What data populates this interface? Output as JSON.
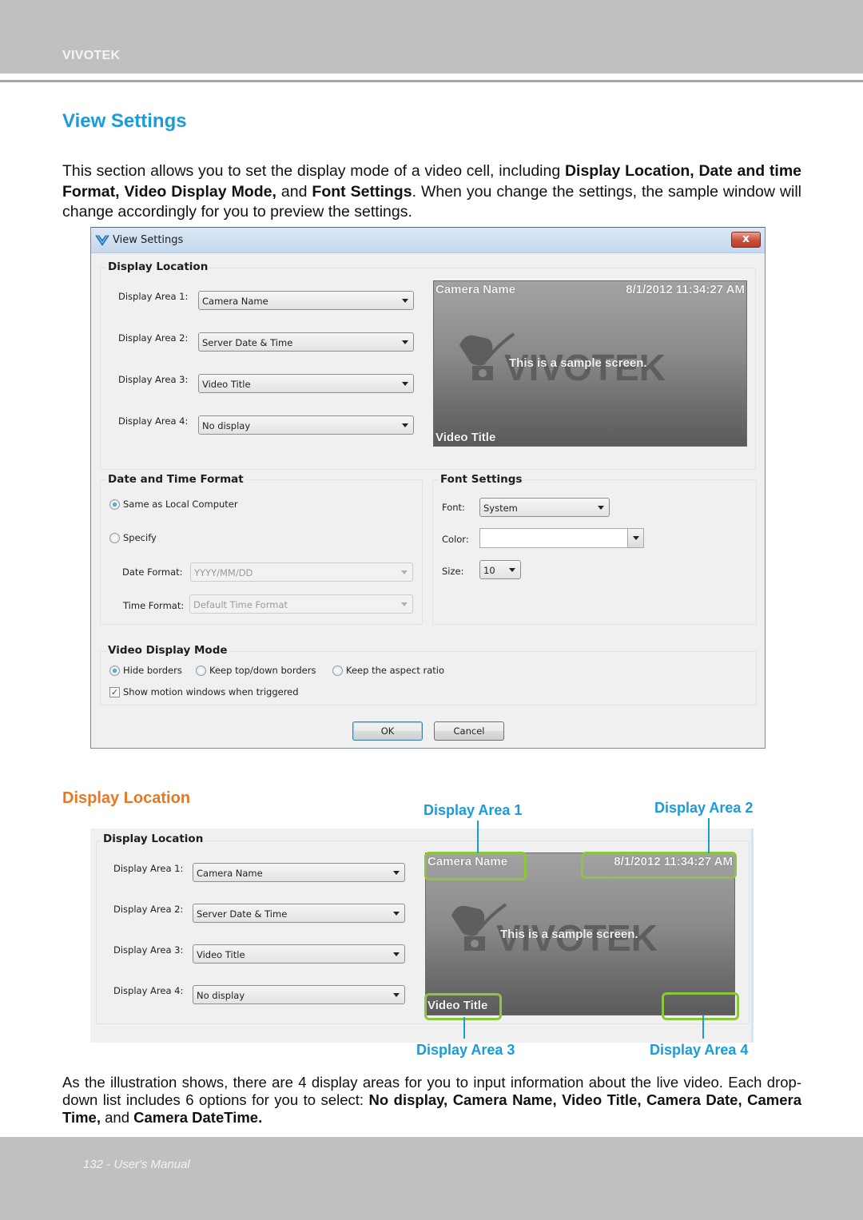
{
  "header": {
    "brand": "VIVOTEK"
  },
  "section_title": "View Settings",
  "intro": {
    "parts": [
      {
        "t": "This section allows you to set the display mode of a video cell, including ",
        "b": false
      },
      {
        "t": "Display Location, Date and time Format, Video Display Mode,",
        "b": true
      },
      {
        "t": " and ",
        "b": false
      },
      {
        "t": "Font Settings",
        "b": true
      },
      {
        "t": ". When you change the settings, the sample window will change accordingly for you to preview the settings.",
        "b": false
      }
    ]
  },
  "dialog": {
    "title": "View Settings",
    "close_glyph": "x",
    "display_location": {
      "title": "Display Location",
      "areas": [
        {
          "label": "Display Area 1:",
          "value": "Camera Name"
        },
        {
          "label": "Display Area 2:",
          "value": "Server Date & Time"
        },
        {
          "label": "Display Area 3:",
          "value": "Video Title"
        },
        {
          "label": "Display Area 4:",
          "value": "No display"
        }
      ]
    },
    "preview": {
      "top_left": "Camera Name",
      "top_right": "8/1/2012 11:34:27 AM",
      "center": "This is a sample screen.",
      "bottom_left": "Video Title",
      "watermark": "VIVOTEK"
    },
    "date_time_format": {
      "title": "Date and Time Format",
      "option_local": "Same as Local Computer",
      "option_specify": "Specify",
      "selected": "local",
      "date_format_label": "Date Format:",
      "date_format_value": "YYYY/MM/DD",
      "time_format_label": "Time Format:",
      "time_format_value": "Default Time Format"
    },
    "font_settings": {
      "title": "Font Settings",
      "font_label": "Font:",
      "font_value": "System",
      "color_label": "Color:",
      "color_value": "#ffffff",
      "size_label": "Size:",
      "size_value": "10"
    },
    "video_display_mode": {
      "title": "Video Display Mode",
      "options": [
        "Hide borders",
        "Keep top/down borders",
        "Keep the aspect ratio"
      ],
      "selected_index": 0,
      "motion_checkbox_label": "Show motion windows when triggered",
      "motion_checked": true
    },
    "ok_label": "OK",
    "cancel_label": "Cancel"
  },
  "subsection_title": "Display Location",
  "illustration": {
    "group_title": "Display Location",
    "areas": [
      {
        "label": "Display Area 1:",
        "value": "Camera Name"
      },
      {
        "label": "Display Area 2:",
        "value": "Server Date & Time"
      },
      {
        "label": "Display Area 3:",
        "value": "Video Title"
      },
      {
        "label": "Display Area 4:",
        "value": "No display"
      }
    ],
    "preview": {
      "top_left": "Camera Name",
      "top_right": "8/1/2012 11:34:27 AM",
      "center": "This is a sample screen.",
      "bottom_left": "Video Title",
      "watermark": "VIVOTEK"
    },
    "callouts": [
      "Display Area 1",
      "Display Area 2",
      "Display Area 3",
      "Display Area 4"
    ],
    "highlight_color": "#8cc63e",
    "callout_color": "#1a9bdc"
  },
  "outro": {
    "parts": [
      {
        "t": "As the illustration shows, there are 4 display areas for you to input information about the live video. Each drop-down list includes 6 options for you to select: ",
        "b": false
      },
      {
        "t": "No display, Camera Name, Video Title, Camera Date, Camera Time,",
        "b": true
      },
      {
        "t": " and ",
        "b": false
      },
      {
        "t": "Camera DateTime.",
        "b": true
      }
    ]
  },
  "footer": {
    "text": "132 - User's Manual"
  }
}
